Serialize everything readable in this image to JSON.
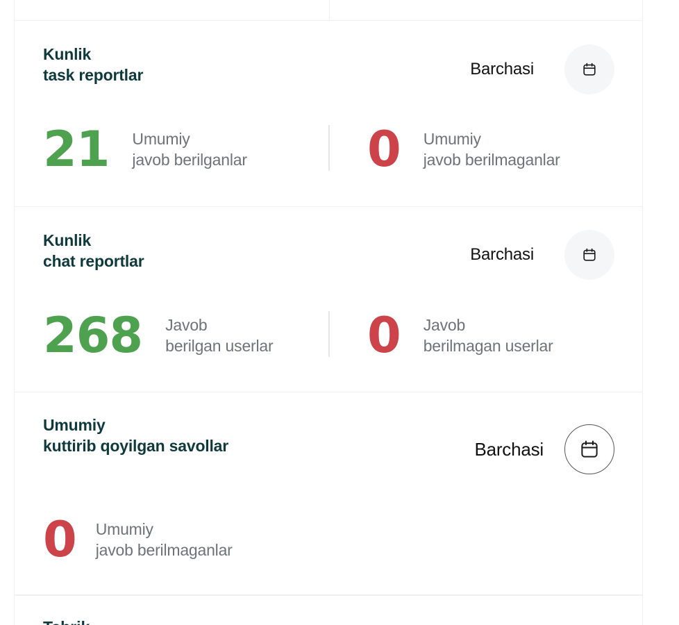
{
  "cards": [
    {
      "title_line1": "Kunlik",
      "title_line2": "task reportlar",
      "action_label": "Barchasi",
      "answered": {
        "value": "21",
        "label_line1": "Umumiy",
        "label_line2": "javob berilganlar"
      },
      "unanswered": {
        "value": "0",
        "label_line1": "Umumiy",
        "label_line2": "javob berilmaganlar"
      }
    },
    {
      "title_line1": "Kunlik",
      "title_line2": "chat reportlar",
      "action_label": "Barchasi",
      "answered": {
        "value": "268",
        "label_line1": "Javob",
        "label_line2": "berilgan userlar"
      },
      "unanswered": {
        "value": "0",
        "label_line1": "Javob",
        "label_line2": "berilmagan userlar"
      }
    },
    {
      "title_line1": "Umumiy",
      "title_line2": "kuttirib qoyilgan savollar",
      "action_label": "Barchasi",
      "unanswered": {
        "value": "0",
        "label_line1": "Umumiy",
        "label_line2": "javob berilmaganlar"
      }
    }
  ],
  "next_card_title_peek": "Tabrik",
  "colors": {
    "title": "#0f3a3d",
    "positive": "#4ea24f",
    "negative": "#cc4349",
    "muted_text": "#6d7377",
    "icon_button_bg": "#f5f6f7"
  },
  "icons": [
    "calendar-icon"
  ]
}
